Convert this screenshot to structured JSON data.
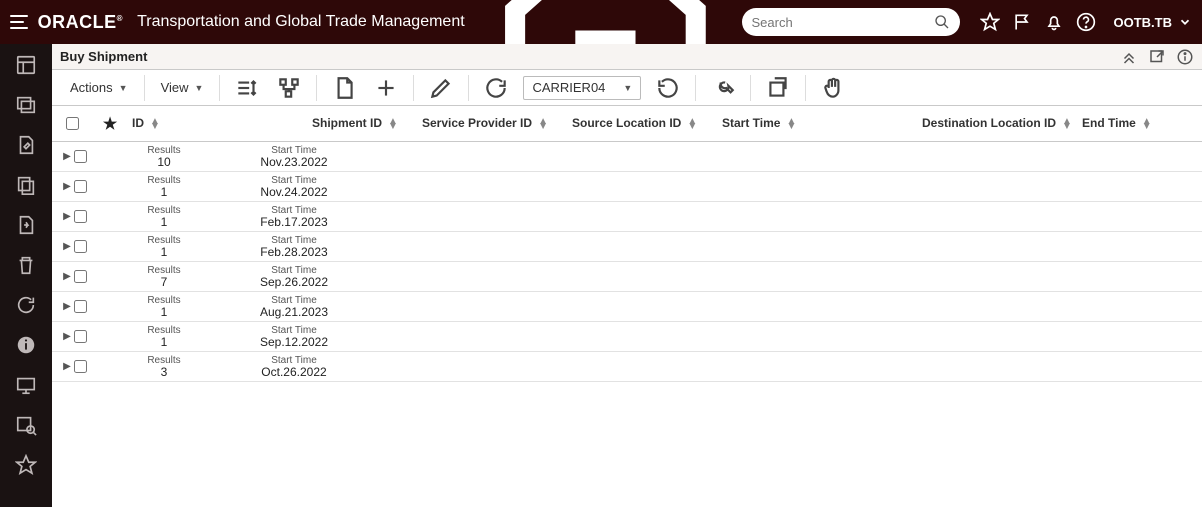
{
  "header": {
    "brand": "ORACLE",
    "app_title": "Transportation and Global Trade Management",
    "search_placeholder": "Search",
    "user_label": "OOTB.TB"
  },
  "page": {
    "title": "Buy Shipment"
  },
  "toolbar": {
    "actions_label": "Actions",
    "view_label": "View",
    "carrier_selected": "CARRIER04"
  },
  "columns": {
    "id": "ID",
    "shipment_id": "Shipment ID",
    "service_provider_id": "Service Provider ID",
    "source_location_id": "Source Location ID",
    "start_time": "Start Time",
    "destination_location_id": "Destination Location ID",
    "end_time": "End Time"
  },
  "row_labels": {
    "results": "Results",
    "start_time": "Start Time"
  },
  "rows": [
    {
      "results": "10",
      "start_time": "Nov.23.2022"
    },
    {
      "results": "1",
      "start_time": "Nov.24.2022"
    },
    {
      "results": "1",
      "start_time": "Feb.17.2023"
    },
    {
      "results": "1",
      "start_time": "Feb.28.2023"
    },
    {
      "results": "7",
      "start_time": "Sep.26.2022"
    },
    {
      "results": "1",
      "start_time": "Aug.21.2023"
    },
    {
      "results": "1",
      "start_time": "Sep.12.2022"
    },
    {
      "results": "3",
      "start_time": "Oct.26.2022"
    }
  ]
}
